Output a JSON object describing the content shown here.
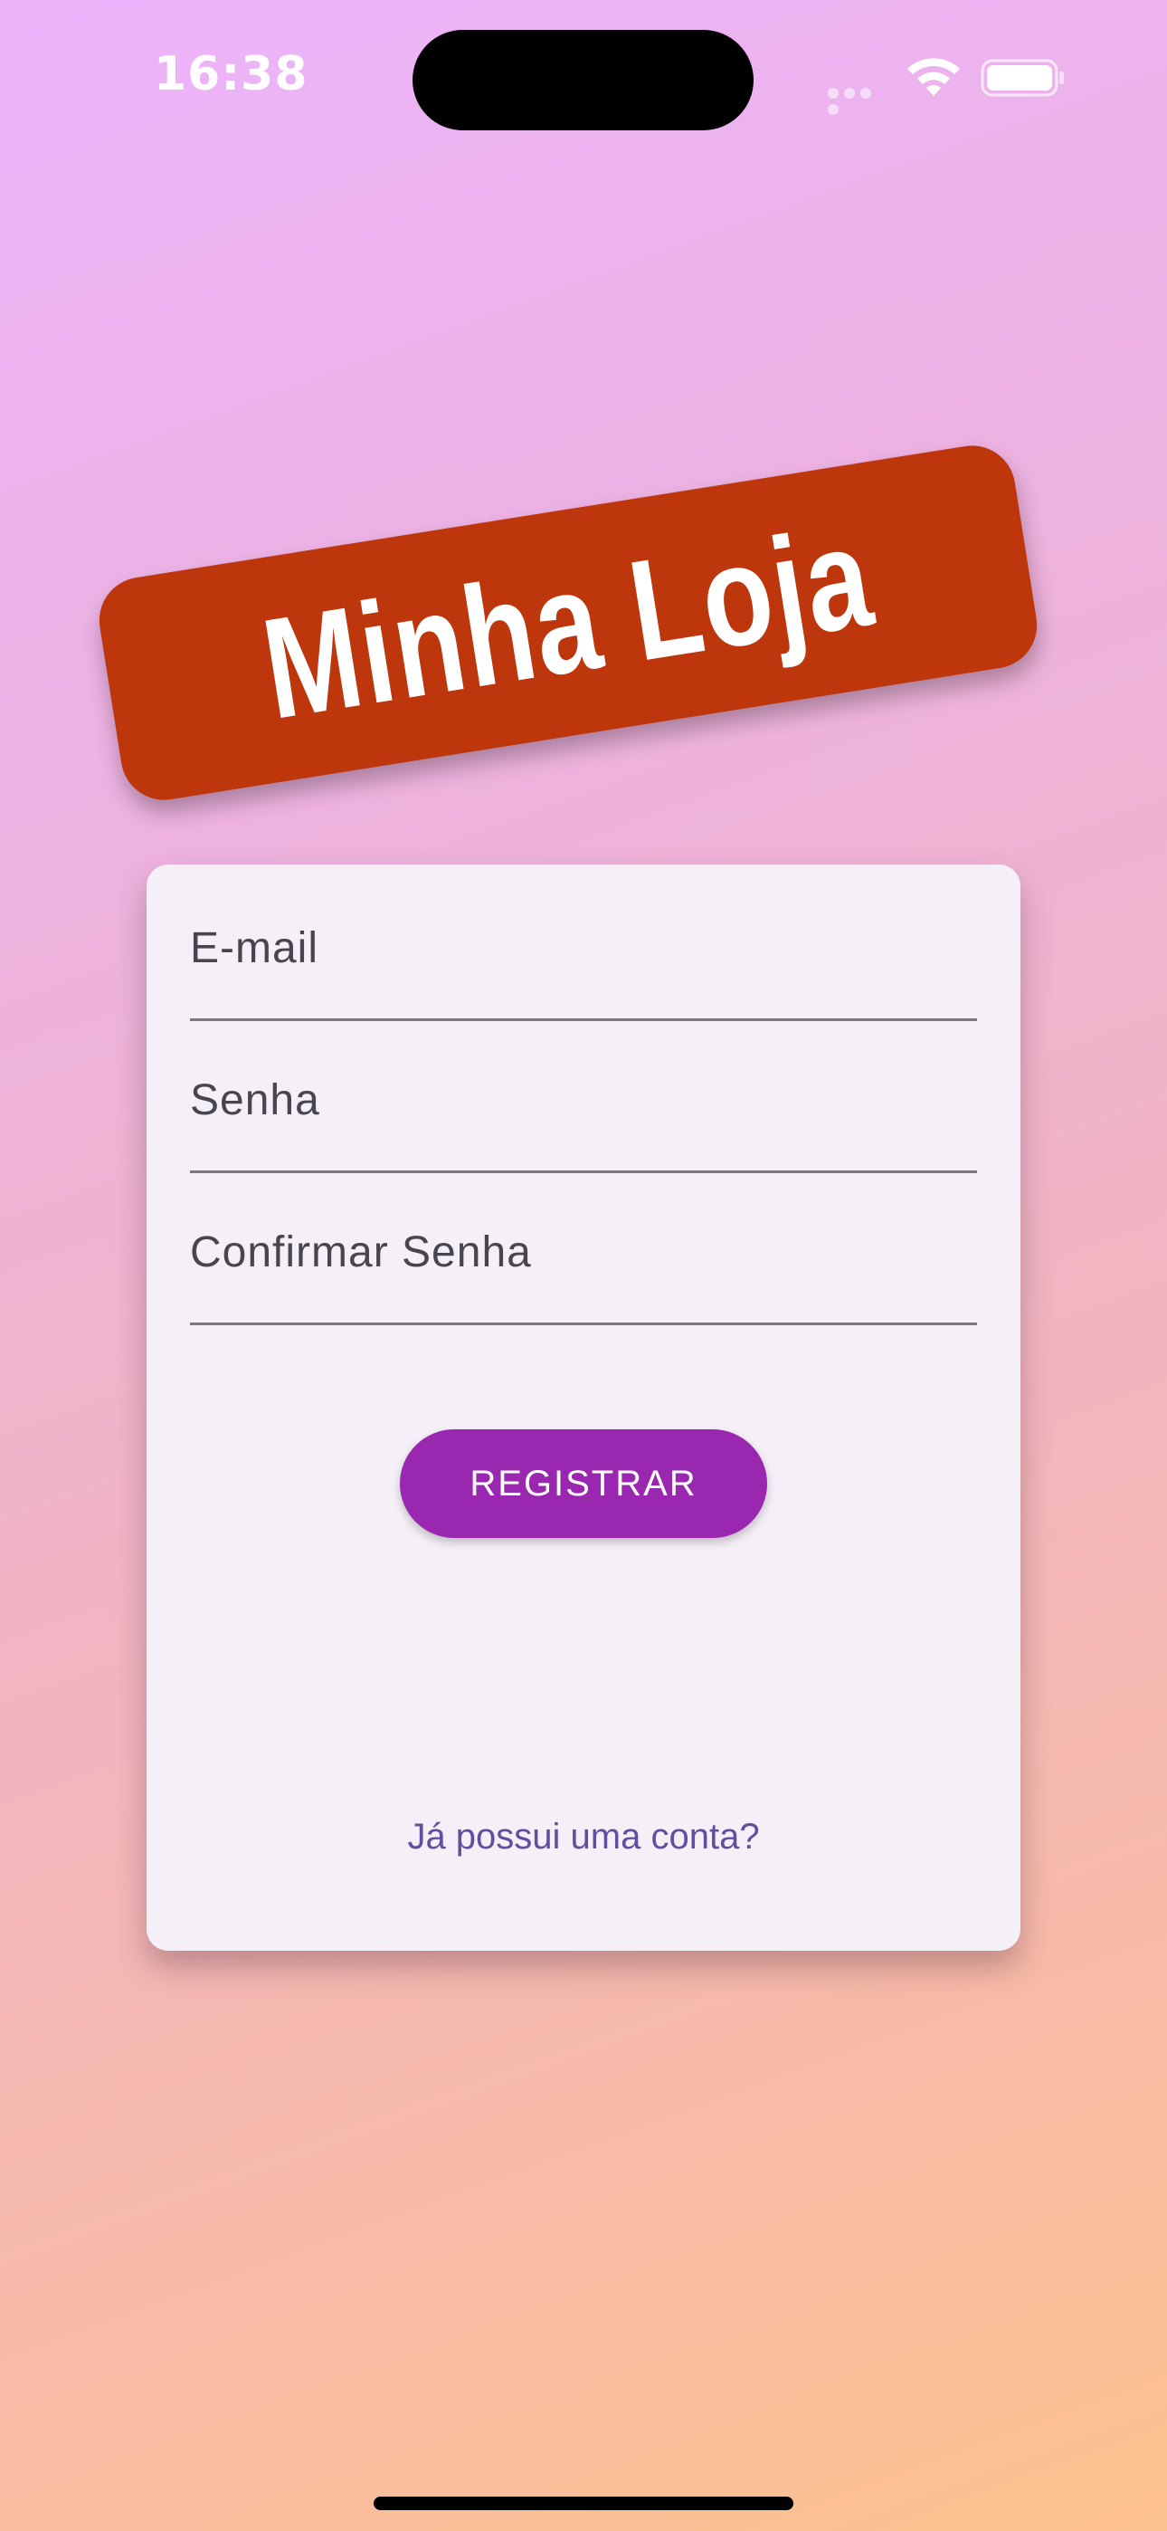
{
  "status_bar": {
    "time": "16:38",
    "icons": [
      "cellular-dots-icon",
      "wifi-icon",
      "battery-icon"
    ]
  },
  "logo": {
    "text": "Minha Loja",
    "background_color": "#bd360c"
  },
  "form": {
    "email_label": "E-mail",
    "password_label": "Senha",
    "confirm_password_label": "Confirmar Senha",
    "register_label": "REGISTRAR",
    "login_link": "Já possui uma conta?"
  },
  "colors": {
    "primary": "#9a27b0",
    "link": "#5e4f9f",
    "card": "#f5f0f8"
  }
}
